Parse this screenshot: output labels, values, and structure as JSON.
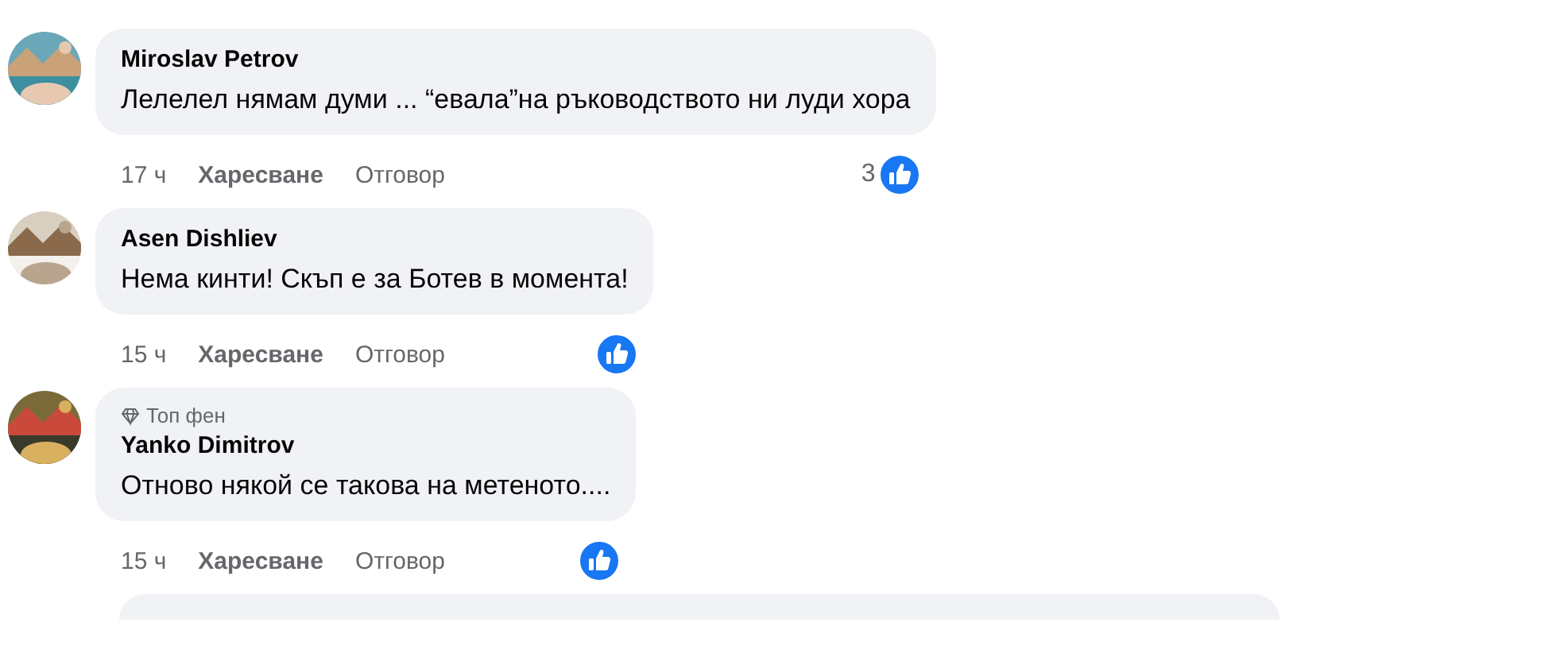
{
  "comments": [
    {
      "author": "Miroslav Petrov",
      "text": "Лелелел нямам думи ... “евала”на ръководството ни луди хора",
      "time": "17 ч",
      "like": "Харесване",
      "reply": "Отговор",
      "reaction_count": "3"
    },
    {
      "author": "Asen Dishliev",
      "text": "Нема кинти! Скъп е за Ботев в момента!",
      "time": "15 ч",
      "like": "Харесване",
      "reply": "Отговор"
    },
    {
      "author": "Yanko Dimitrov",
      "badge": "Топ фен",
      "text": "Отново някой се такова на метеното....",
      "time": "15 ч",
      "like": "Харесване",
      "reply": "Отговор"
    }
  ]
}
